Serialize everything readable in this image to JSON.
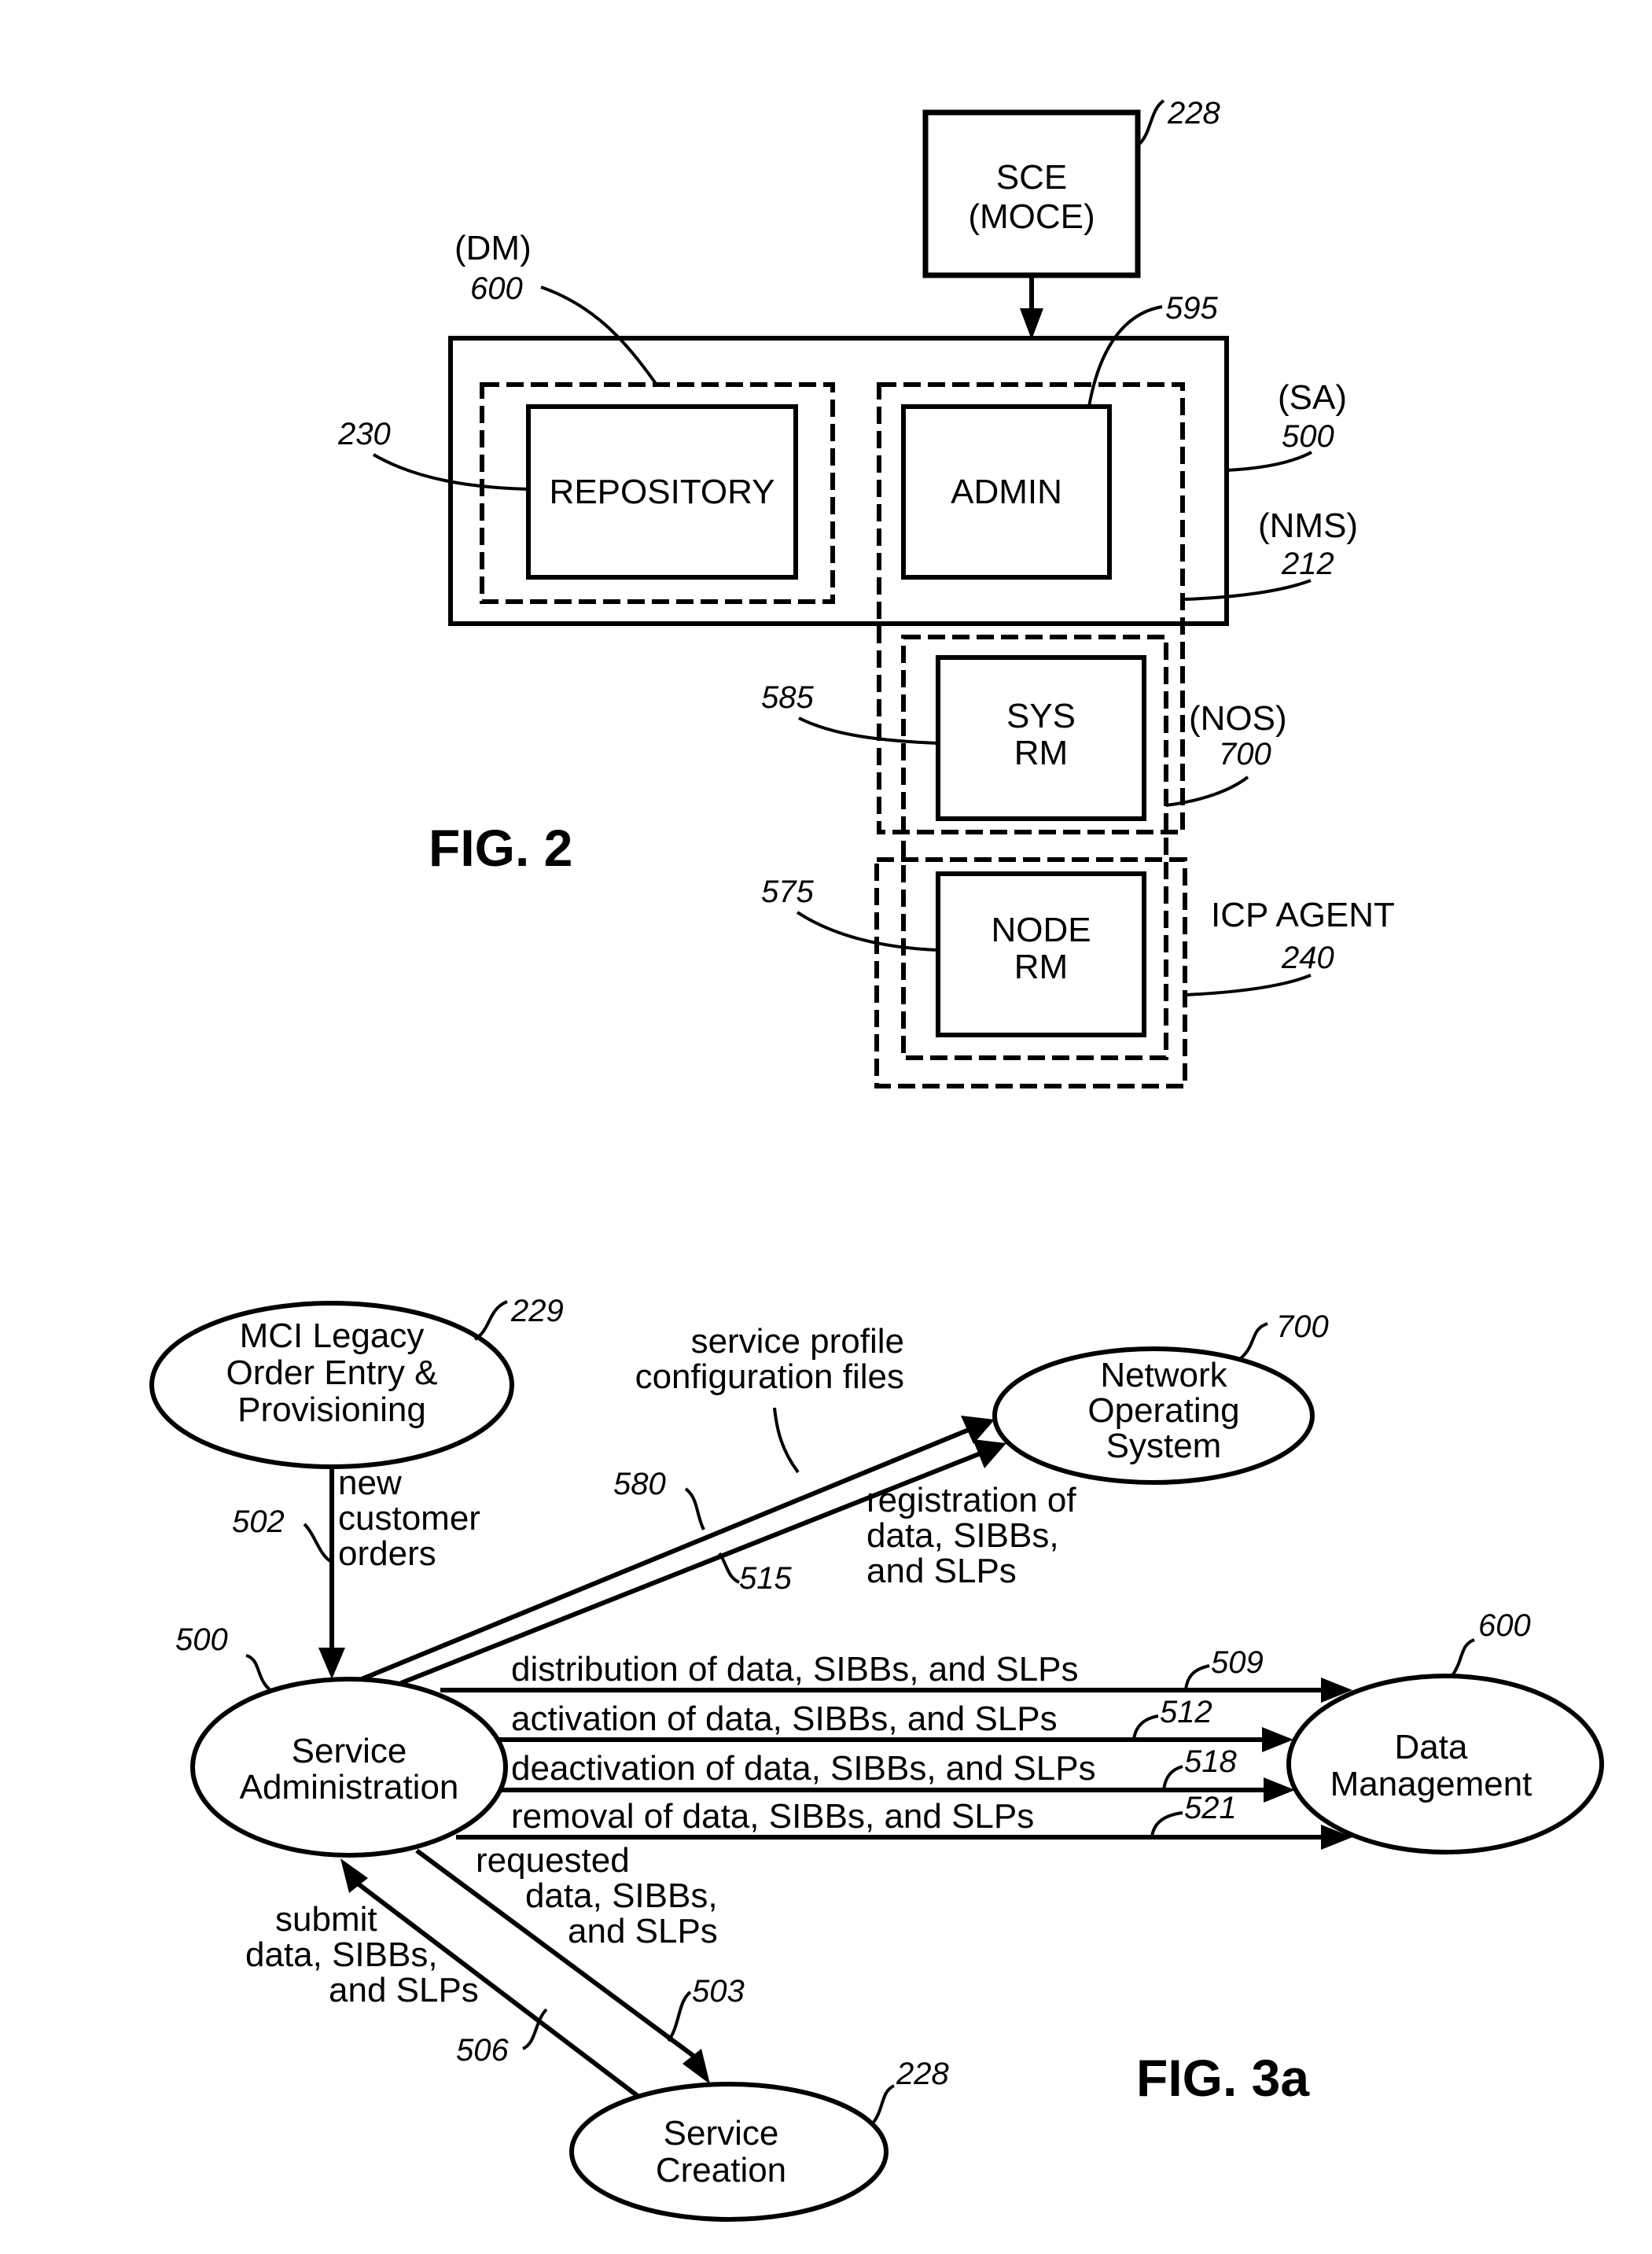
{
  "fig2": {
    "caption": "FIG. 2",
    "sce_box": {
      "line1": "SCE",
      "line2": "(MOCE)",
      "ref": "228"
    },
    "repository": {
      "label": "REPOSITORY",
      "ref": "230"
    },
    "admin": {
      "label": "ADMIN",
      "ref": "595"
    },
    "sys_rm": {
      "line1": "SYS",
      "line2": "RM",
      "ref": "585"
    },
    "node_rm": {
      "line1": "NODE",
      "line2": "RM",
      "ref": "575"
    },
    "dm_group": {
      "abbr": "(DM)",
      "ref": "600"
    },
    "sa_group": {
      "abbr": "(SA)",
      "ref": "500"
    },
    "nms_group": {
      "abbr": "(NMS)",
      "ref": "212"
    },
    "nos_group": {
      "abbr": "(NOS)",
      "ref": "700"
    },
    "icp_group": {
      "abbr": "ICP AGENT",
      "ref": "240"
    }
  },
  "fig3a": {
    "caption": "FIG. 3a",
    "nodes": {
      "legacy": {
        "lines": [
          "MCI Legacy",
          "Order Entry &",
          "Provisioning"
        ],
        "ref": "229"
      },
      "service_admin": {
        "lines": [
          "Service",
          "Administration"
        ],
        "ref": "500"
      },
      "nos": {
        "lines": [
          "Network",
          "Operating",
          "System"
        ],
        "ref": "700"
      },
      "data_mgmt": {
        "lines": [
          "Data",
          "Management"
        ],
        "ref": "600"
      },
      "service_creation": {
        "lines": [
          "Service",
          "Creation"
        ],
        "ref": "228"
      }
    },
    "flows": {
      "new_orders": {
        "lines": [
          "new",
          "customer",
          "orders"
        ],
        "ref": "502"
      },
      "service_profile": {
        "lines": [
          "service profile",
          "configuration files"
        ],
        "ref": "580"
      },
      "registration": {
        "lines": [
          "registration of",
          "data, SIBBs,",
          "and SLPs"
        ],
        "ref": "515"
      },
      "distribution": {
        "label": "distribution of data, SIBBs, and SLPs",
        "ref": "509"
      },
      "activation": {
        "label": "activation of data, SIBBs, and SLPs",
        "ref": "512"
      },
      "deactivation": {
        "label": "deactivation of data, SIBBs, and SLPs",
        "ref": "518"
      },
      "removal": {
        "label": "removal of data, SIBBs, and SLPs",
        "ref": "521"
      },
      "requested": {
        "lines": [
          "requested",
          "data, SIBBs,",
          "and SLPs"
        ],
        "ref": "503"
      },
      "submit": {
        "lines": [
          "submit",
          "data, SIBBs,",
          "and SLPs"
        ],
        "ref": "506"
      }
    }
  }
}
